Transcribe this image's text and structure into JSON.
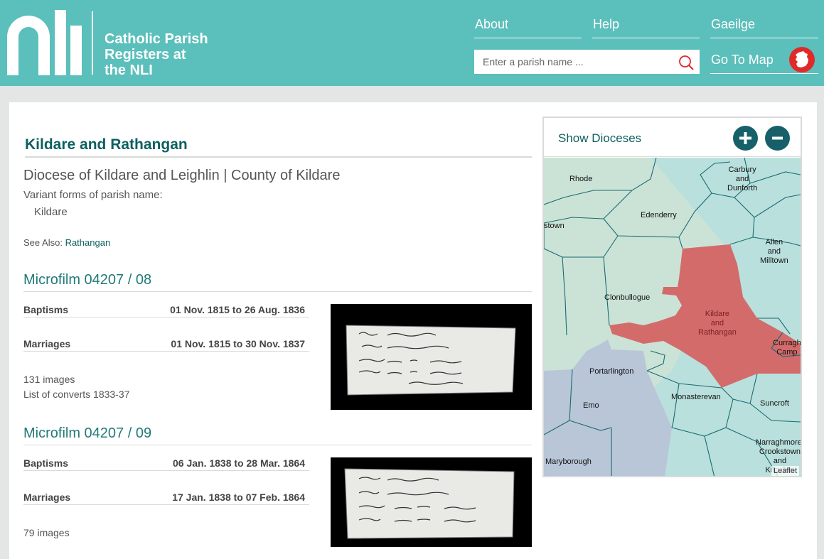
{
  "header": {
    "logo_text": "nli",
    "title_lines": [
      "Catholic Parish",
      "Registers at",
      "the NLI"
    ],
    "nav": {
      "about": "About",
      "help": "Help",
      "gaeilge": "Gaeilge"
    },
    "search": {
      "placeholder": "Enter a parish name ..."
    },
    "go_to_map": "Go To Map",
    "brand_color": "#5bbfbb",
    "accent_color": "#e02a2a"
  },
  "parish": {
    "title": "Kildare and Rathangan",
    "diocese_line": "Diocese of Kildare and Leighlin | County of Kildare",
    "variant_label": "Variant forms of parish name:",
    "variant_names": [
      "Kildare"
    ],
    "see_also_label": "See Also:",
    "see_also_link": "Rathangan"
  },
  "microfilms": [
    {
      "title": "Microfilm 04207 / 08",
      "records": [
        {
          "type": "Baptisms",
          "dates": "01 Nov. 1815 to 26 Aug. 1836"
        },
        {
          "type": "Marriages",
          "dates": "01 Nov. 1815 to 30 Nov. 1837"
        }
      ],
      "images": "131 images",
      "note": "List of converts 1833-37"
    },
    {
      "title": "Microfilm 04207 / 09",
      "records": [
        {
          "type": "Baptisms",
          "dates": "06 Jan. 1838 to 28 Mar. 1864"
        },
        {
          "type": "Marriages",
          "dates": "17 Jan. 1838 to 07 Feb. 1864"
        }
      ],
      "images": "79 images"
    }
  ],
  "map": {
    "show_dioceses": "Show Dioceses",
    "labels": {
      "rhode": "Rhode",
      "carbury": "Carbury\nand\nDunforth",
      "edenderry": "Edenderry",
      "stown": "stown",
      "allen": "Allen\nand\nMilltown",
      "clonbullogue": "Clonbullogue",
      "kildare": "Kildare\nand\nRathangan",
      "curragh": "Curragh\nCamp",
      "portarlington": "Portarlington",
      "emo": "Emo",
      "monasterevan": "Monasterevan",
      "suncroft": "Suncroft",
      "maryborough": "Maryborough",
      "narraghmore": "Narraghmore,\nCrookstown\nand\nKilcullen"
    },
    "attribution": "Leaflet",
    "colors": {
      "selected": "#d46b6b",
      "kildare_leighlin": "#b9e0dc",
      "other": "#cbe3d6",
      "laois": "#b9c6d8"
    }
  }
}
